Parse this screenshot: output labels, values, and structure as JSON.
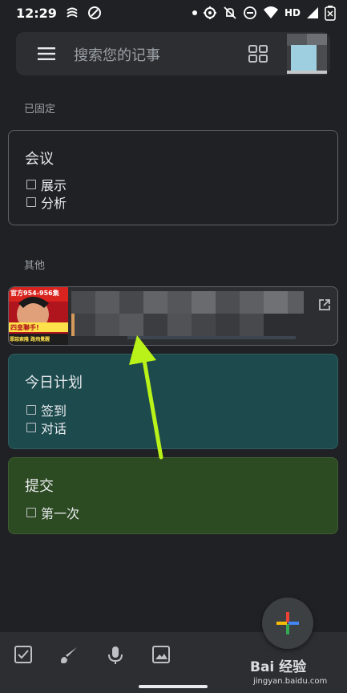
{
  "status_bar": {
    "time": "12:29",
    "network_label": "HD",
    "left_icons": [
      "sync-icon",
      "data-saver-icon"
    ],
    "right_icons": [
      "dot-icon",
      "location-icon",
      "mute-icon",
      "dnd-icon",
      "wifi-icon",
      "signal-icon",
      "battery-icon"
    ]
  },
  "search": {
    "placeholder": "搜索您的记事",
    "menu_icon": "menu-icon",
    "view_icon": "grid-view-icon"
  },
  "sections": {
    "pinned_label": "已固定",
    "others_label": "其他"
  },
  "notes": {
    "meeting": {
      "title": "会议",
      "items": [
        {
          "text": "展示",
          "checked": false
        },
        {
          "text": "分析",
          "checked": false
        }
      ],
      "color": "#202124"
    },
    "link_card": {
      "icon": "open-in-new-icon",
      "thumb_text": [
        "官方954-956集",
        "四皇聯手!",
        "罪惡索隆 路飛覺醒"
      ]
    },
    "today": {
      "title": "今日计划",
      "items": [
        {
          "text": "签到",
          "checked": false
        },
        {
          "text": "对话",
          "checked": false
        }
      ],
      "color": "#1c4a4d"
    },
    "submit": {
      "title": "提交",
      "items": [
        {
          "text": "第一次",
          "checked": false
        }
      ],
      "color": "#2d4b22"
    }
  },
  "bottom_bar": {
    "icons": [
      "checkbox-icon",
      "brush-icon",
      "mic-icon",
      "image-icon"
    ],
    "fab_icon": "plus-icon"
  },
  "watermark": {
    "line1": "Bai 经验",
    "line2": "jingyan.baidu.com"
  },
  "colors": {
    "background": "#202124",
    "surface": "#2d2e31",
    "border": "#5f6368",
    "arrow": "#b8f218"
  }
}
